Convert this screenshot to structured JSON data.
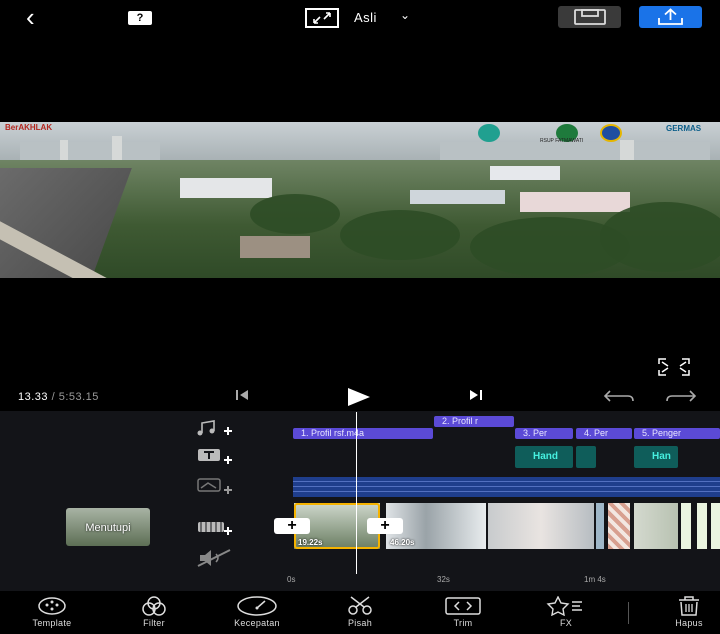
{
  "topbar": {
    "help_label": "?",
    "aspect_label": "Asli"
  },
  "preview": {
    "watermark_left": "BerAKHLAK",
    "watermark_right": "GERMAS",
    "hospital_label": "RSUP FATMAWATI"
  },
  "playback": {
    "current_time": "13.33",
    "total_time": "5:53.15"
  },
  "tracks": {
    "audio_clips": [
      {
        "label": "2. Profil r"
      },
      {
        "label": "1. Profil rsf.m4a"
      },
      {
        "label": "3. Per"
      },
      {
        "label": "4. Per"
      },
      {
        "label": "5. Penger"
      }
    ],
    "text_clips": [
      {
        "label": "Hand"
      },
      {
        "label": ""
      },
      {
        "label": "Han"
      }
    ],
    "cover_label": "Menutupi",
    "video_clips": [
      {
        "duration": "19.22s"
      },
      {
        "duration": "46.20s"
      }
    ],
    "ruler_marks": [
      "0s",
      "32s",
      "1m 4s"
    ]
  },
  "toolbar": {
    "tools": [
      {
        "label": "Template",
        "icon": "template-icon"
      },
      {
        "label": "Filter",
        "icon": "filter-icon"
      },
      {
        "label": "Kecepatan",
        "icon": "speed-icon"
      },
      {
        "label": "Pisah",
        "icon": "scissors-icon"
      },
      {
        "label": "Trim",
        "icon": "trim-icon"
      },
      {
        "label": "FX",
        "icon": "star-fx-icon"
      },
      {
        "label": "Hapus",
        "icon": "trash-icon"
      }
    ]
  },
  "colors": {
    "accent_blue": "#1a73e8",
    "audio_purple": "#5b4ad6",
    "text_teal": "#0f5d5a",
    "selection_yellow": "#f5b300"
  }
}
